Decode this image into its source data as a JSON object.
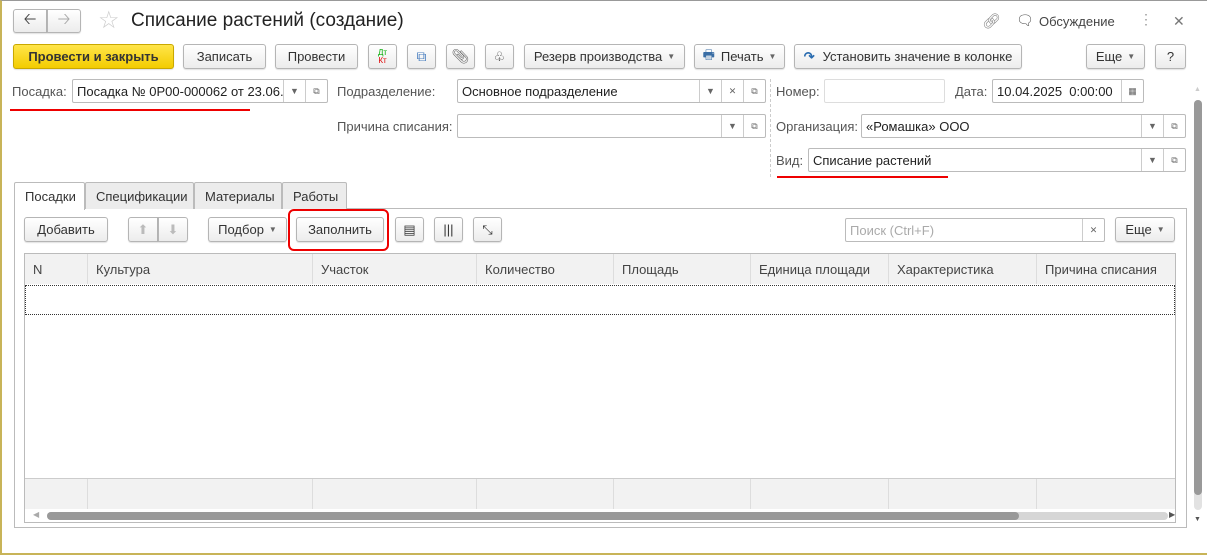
{
  "header": {
    "title": "Списание растений (создание)",
    "discussion": "Обсуждение"
  },
  "toolbar": {
    "post_close": "Провести и закрыть",
    "save": "Записать",
    "post": "Провести",
    "dtkt_dt": "Дт",
    "dtkt_kt": "Кт",
    "reserve": "Резерв производства",
    "print": "Печать",
    "set_column": "Установить значение в колонке",
    "more": "Еще",
    "help": "?"
  },
  "form": {
    "planting_label": "Посадка:",
    "planting_value": "Посадка № 0Р00-000062 от 23.06.",
    "division_label": "Подразделение:",
    "division_value": "Основное подразделение",
    "reason_label": "Причина списания:",
    "reason_value": "",
    "number_label": "Номер:",
    "number_value": "",
    "date_label": "Дата:",
    "date_value": "10.04.2025  0:00:00",
    "org_label": "Организация:",
    "org_value": "«Ромашка» ООО",
    "kind_label": "Вид:",
    "kind_value": "Списание растений"
  },
  "tabs": [
    "Посадки",
    "Спецификации",
    "Материалы",
    "Работы"
  ],
  "table_toolbar": {
    "add": "Добавить",
    "pick": "Подбор",
    "fill": "Заполнить",
    "search_placeholder": "Поиск (Ctrl+F)",
    "more": "Еще"
  },
  "table": {
    "columns": [
      "N",
      "Культура",
      "Участок",
      "Количество",
      "Площадь",
      "Единица площади",
      "Характеристика",
      "Причина списания"
    ],
    "rows": []
  },
  "colors": {
    "accent": "#f3cc00",
    "highlight": "#e00000"
  }
}
